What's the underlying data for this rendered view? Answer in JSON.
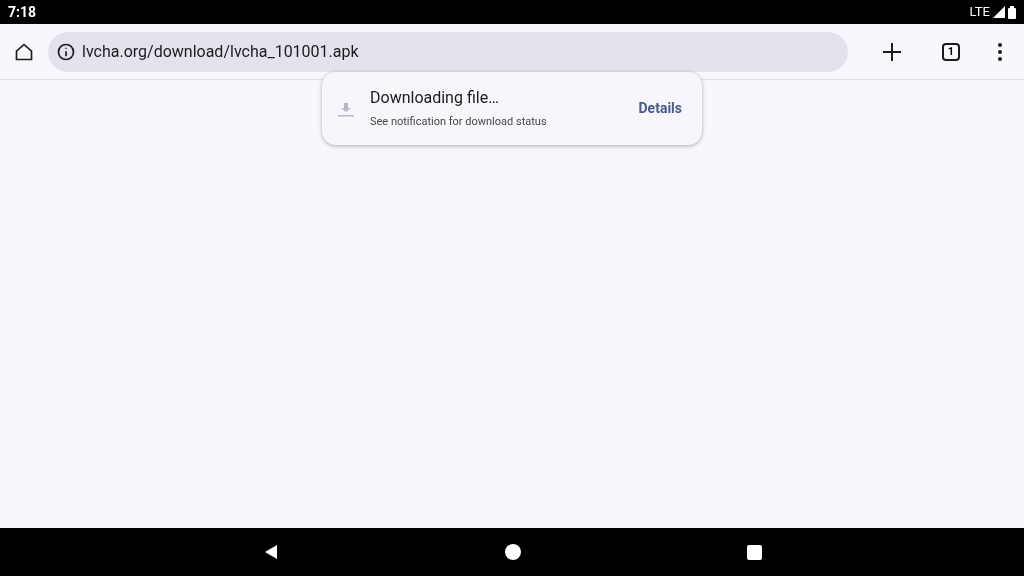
{
  "status_bar": {
    "time": "7:18",
    "network": "LTE"
  },
  "toolbar": {
    "url": "lvcha.org/download/lvcha_101001.apk",
    "tab_count": "1"
  },
  "download_popup": {
    "title": "Downloading file…",
    "subtitle": "See notification for download status",
    "action": "Details"
  }
}
